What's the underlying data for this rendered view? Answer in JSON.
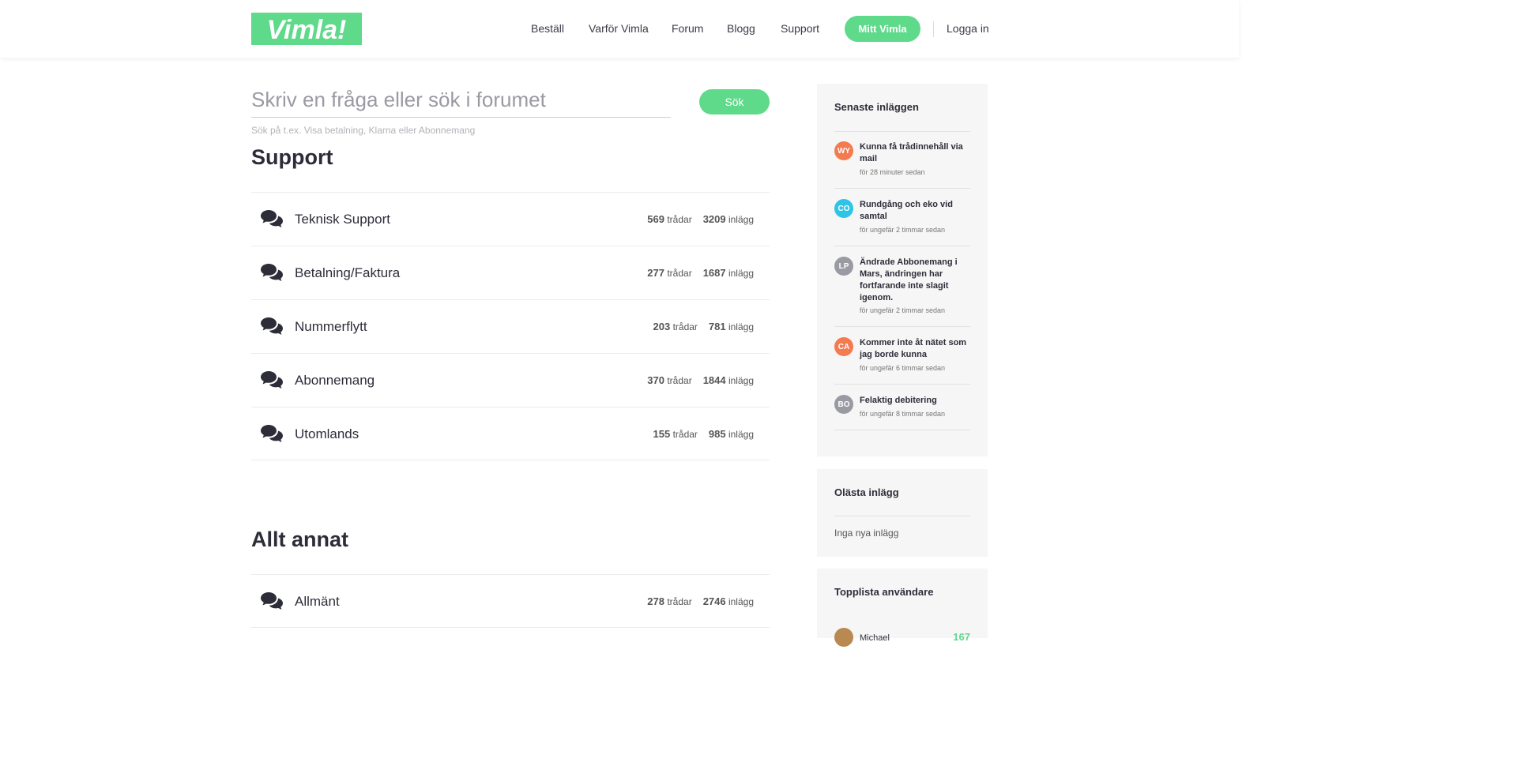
{
  "brand": {
    "logo_text": "Vimla!",
    "accent": "#5fd98a"
  },
  "nav": {
    "items": [
      "Beställ",
      "Varför Vimla",
      "Forum",
      "Blogg",
      "Support"
    ],
    "cta_label": "Mitt Vimla",
    "login_label": "Logga in"
  },
  "search": {
    "placeholder": "Skriv en fråga eller sök i forumet",
    "button_label": "Sök",
    "hint": "Sök på t.ex. Visa betalning, Klarna eller Abonnemang"
  },
  "sections": [
    {
      "title": "Support",
      "forums": [
        {
          "name": "Teknisk Support",
          "threads": "569",
          "threads_label": "trådar",
          "posts": "3209",
          "posts_label": "inlägg"
        },
        {
          "name": "Betalning/Faktura",
          "threads": "277",
          "threads_label": "trådar",
          "posts": "1687",
          "posts_label": "inlägg"
        },
        {
          "name": "Nummerflytt",
          "threads": "203",
          "threads_label": "trådar",
          "posts": "781",
          "posts_label": "inlägg"
        },
        {
          "name": "Abonnemang",
          "threads": "370",
          "threads_label": "trådar",
          "posts": "1844",
          "posts_label": "inlägg"
        },
        {
          "name": "Utomlands",
          "threads": "155",
          "threads_label": "trådar",
          "posts": "985",
          "posts_label": "inlägg"
        }
      ]
    },
    {
      "title": "Allt annat",
      "forums": [
        {
          "name": "Allmänt",
          "threads": "278",
          "threads_label": "trådar",
          "posts": "2746",
          "posts_label": "inlägg"
        }
      ]
    }
  ],
  "sidebar": {
    "latest": {
      "title": "Senaste inläggen",
      "posts": [
        {
          "initials": "WY",
          "color": "#f47b4f",
          "title": "Kunna få trådinnehåll via mail",
          "time": "för 28 minuter sedan"
        },
        {
          "initials": "CO",
          "color": "#2ec4e8",
          "title": "Rundgång och eko vid samtal",
          "time": "för ungefär 2 timmar sedan"
        },
        {
          "initials": "LP",
          "color": "#9a9aa3",
          "title": "Ändrade Abbonemang i Mars, ändringen har fortfarande inte slagit igenom.",
          "time": "för ungefär 2 timmar sedan"
        },
        {
          "initials": "CA",
          "color": "#f47b4f",
          "title": "Kommer inte åt nätet som jag borde kunna",
          "time": "för ungefär 6 timmar sedan"
        },
        {
          "initials": "BO",
          "color": "#9a9aa3",
          "title": "Felaktig debitering",
          "time": "för ungefär 8 timmar sedan"
        }
      ]
    },
    "unread": {
      "title": "Olästa inlägg",
      "empty": "Inga nya inlägg"
    },
    "toplist": {
      "title": "Topplista användare",
      "users": [
        {
          "name": "Michael",
          "score": "167"
        }
      ]
    }
  }
}
